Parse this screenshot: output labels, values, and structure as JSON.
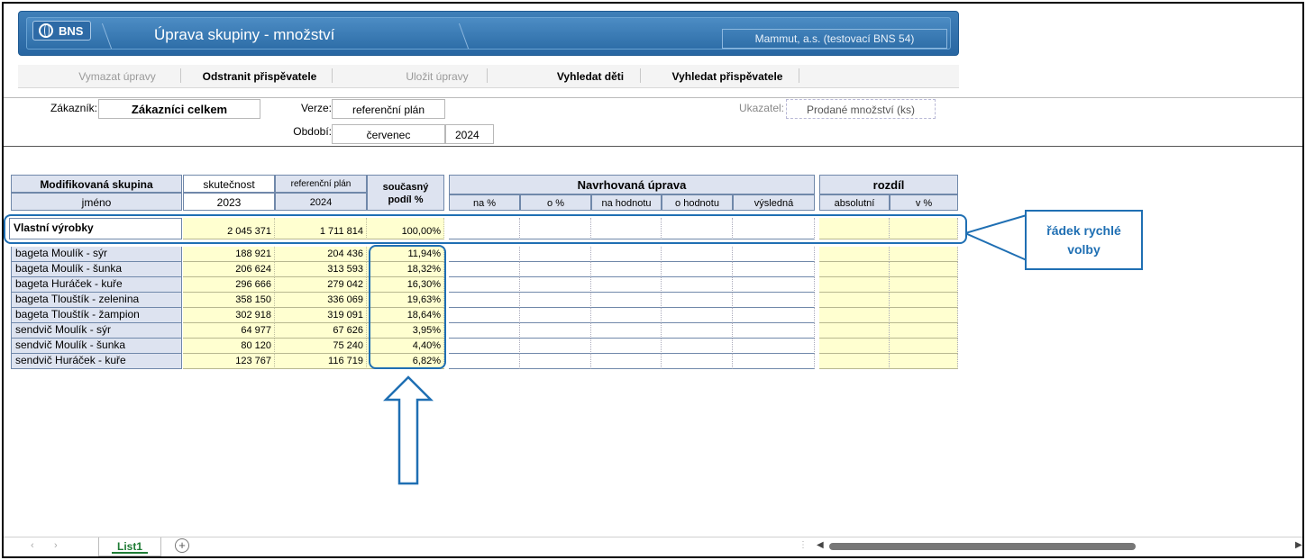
{
  "header": {
    "logo": "BNS",
    "title": "Úprava skupiny - množství",
    "company": "Mammut, a.s. (testovací BNS 54)"
  },
  "toolbar": {
    "clear": "Vymazat úpravy",
    "remove": "Odstranit přispěvatele",
    "save": "Uložit úpravy",
    "find_children": "Vyhledat děti",
    "find_contributors": "Vyhledat přispěvatele"
  },
  "form": {
    "customer_label": "Zákazník:",
    "customer_value": "Zákazníci celkem",
    "version_label": "Verze:",
    "version_value": "referenční plán",
    "period_label": "Období:",
    "period_month": "červenec",
    "period_year": "2024",
    "indicator_label": "Ukazatel:",
    "indicator_value": "Prodané množství (ks)"
  },
  "table": {
    "group_header": "Modifikovaná skupina",
    "name_header": "jméno",
    "actual_header": "skutečnost",
    "actual_year": "2023",
    "ref_header": "referenční plán",
    "ref_year": "2024",
    "share_header_1": "současný",
    "share_header_2": "podíl %",
    "proposal_header": "Navrhovaná úprava",
    "proposal_cols": [
      "na %",
      "o %",
      "na hodnotu",
      "o hodnotu",
      "výsledná"
    ],
    "diff_header": "rozdíl",
    "diff_cols": [
      "absolutní",
      "v %"
    ],
    "total": {
      "name": "Vlastní výrobky",
      "actual": "2 045 371",
      "ref": "1 711 814",
      "share": "100,00%"
    },
    "rows": [
      {
        "name": "bageta Moulík - sýr",
        "actual": "188 921",
        "ref": "204 436",
        "share": "11,94%"
      },
      {
        "name": "bageta Moulík - šunka",
        "actual": "206 624",
        "ref": "313 593",
        "share": "18,32%"
      },
      {
        "name": "bageta Huráček - kuře",
        "actual": "296 666",
        "ref": "279 042",
        "share": "16,30%"
      },
      {
        "name": "bageta Tlouštík - zelenina",
        "actual": "358 150",
        "ref": "336 069",
        "share": "19,63%"
      },
      {
        "name": "bageta Tlouštík - žampion",
        "actual": "302 918",
        "ref": "319 091",
        "share": "18,64%"
      },
      {
        "name": "sendvič Moulík - sýr",
        "actual": "64 977",
        "ref": "67 626",
        "share": "3,95%"
      },
      {
        "name": "sendvič Moulík - šunka",
        "actual": "80 120",
        "ref": "75 240",
        "share": "4,40%"
      },
      {
        "name": "sendvič Huráček - kuře",
        "actual": "123 767",
        "ref": "116 719",
        "share": "6,82%"
      }
    ]
  },
  "annotation": {
    "line1": "řádek rychlé",
    "line2": "volby"
  },
  "sheet": {
    "tab": "List1"
  },
  "colors": {
    "header_blue": "#2e6ea8",
    "callout_blue": "#1f6fb3",
    "input_yellow": "#ffffd0",
    "header_grey": "#dde3f0"
  }
}
